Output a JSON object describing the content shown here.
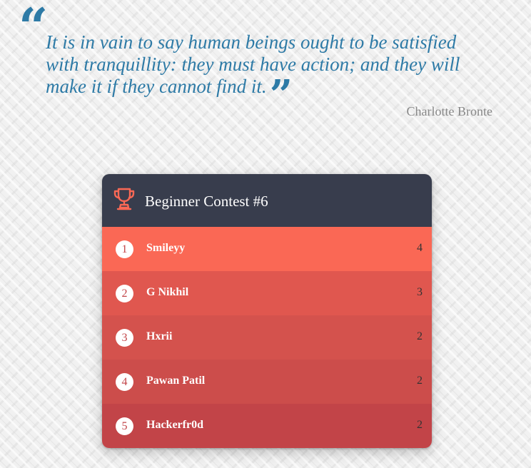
{
  "quote": {
    "open_mark": "“",
    "text": "It is in vain to say human beings ought to be satisfied with tranquillity: they must have action; and they will make it if they cannot find it.",
    "close_mark": "”",
    "author": "Charlotte Bronte"
  },
  "leaderboard": {
    "icon": "trophy-icon",
    "title": "Beginner Contest #6",
    "rows": [
      {
        "rank": "1",
        "name": "Smileyy",
        "score": "4"
      },
      {
        "rank": "2",
        "name": "G Nikhil",
        "score": "3"
      },
      {
        "rank": "3",
        "name": "Hxrii",
        "score": "2"
      },
      {
        "rank": "4",
        "name": "Pawan Patil",
        "score": "2"
      },
      {
        "rank": "5",
        "name": "Hackerfr0d",
        "score": "2"
      }
    ]
  },
  "colors": {
    "quote_text": "#2d7aa6",
    "author_text": "#888888",
    "header_bg": "#383d4d",
    "trophy": "#fa6855",
    "row_1_bg": "#fa6855",
    "row_2_bg": "#e0574f",
    "row_3_bg": "#d4524d",
    "row_4_bg": "#cc4d4b",
    "row_5_bg": "#c24448"
  }
}
